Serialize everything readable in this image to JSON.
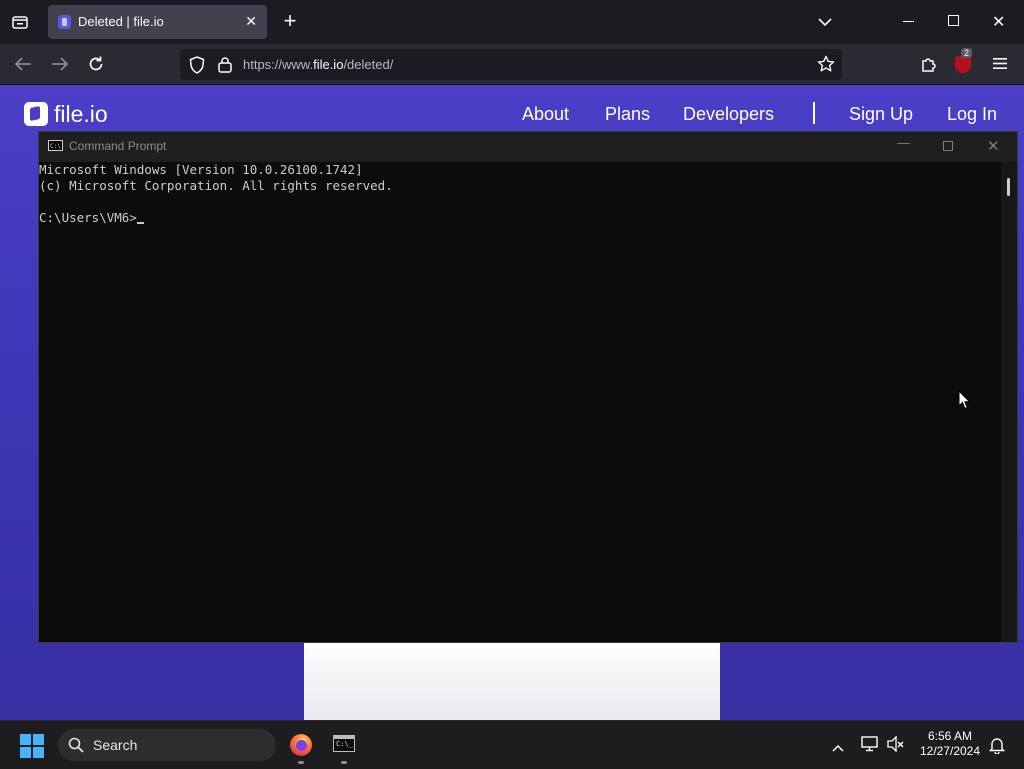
{
  "browser": {
    "tab": {
      "title": "Deleted | file.io"
    },
    "url": {
      "scheme": "https://www.",
      "host": "file.io",
      "path": "/deleted/"
    },
    "extension_badge": "2"
  },
  "site": {
    "logo_text": "file.io",
    "nav": [
      "About",
      "Plans",
      "Developers",
      "Sign Up",
      "Log In"
    ]
  },
  "cmd": {
    "title": "Command Prompt",
    "lines": [
      "Microsoft Windows [Version 10.0.26100.1742]",
      "(c) Microsoft Corporation. All rights reserved.",
      "",
      "C:\\Users\\VM6>"
    ]
  },
  "taskbar": {
    "search_label": "Search",
    "time": "6:56 AM",
    "date": "12/27/2024"
  },
  "colors": {
    "site_gradient_top": "#4a3fc7",
    "site_gradient_bottom": "#3730a3",
    "console_bg": "#0c0c0c",
    "start_blue": "#47b4ff"
  }
}
